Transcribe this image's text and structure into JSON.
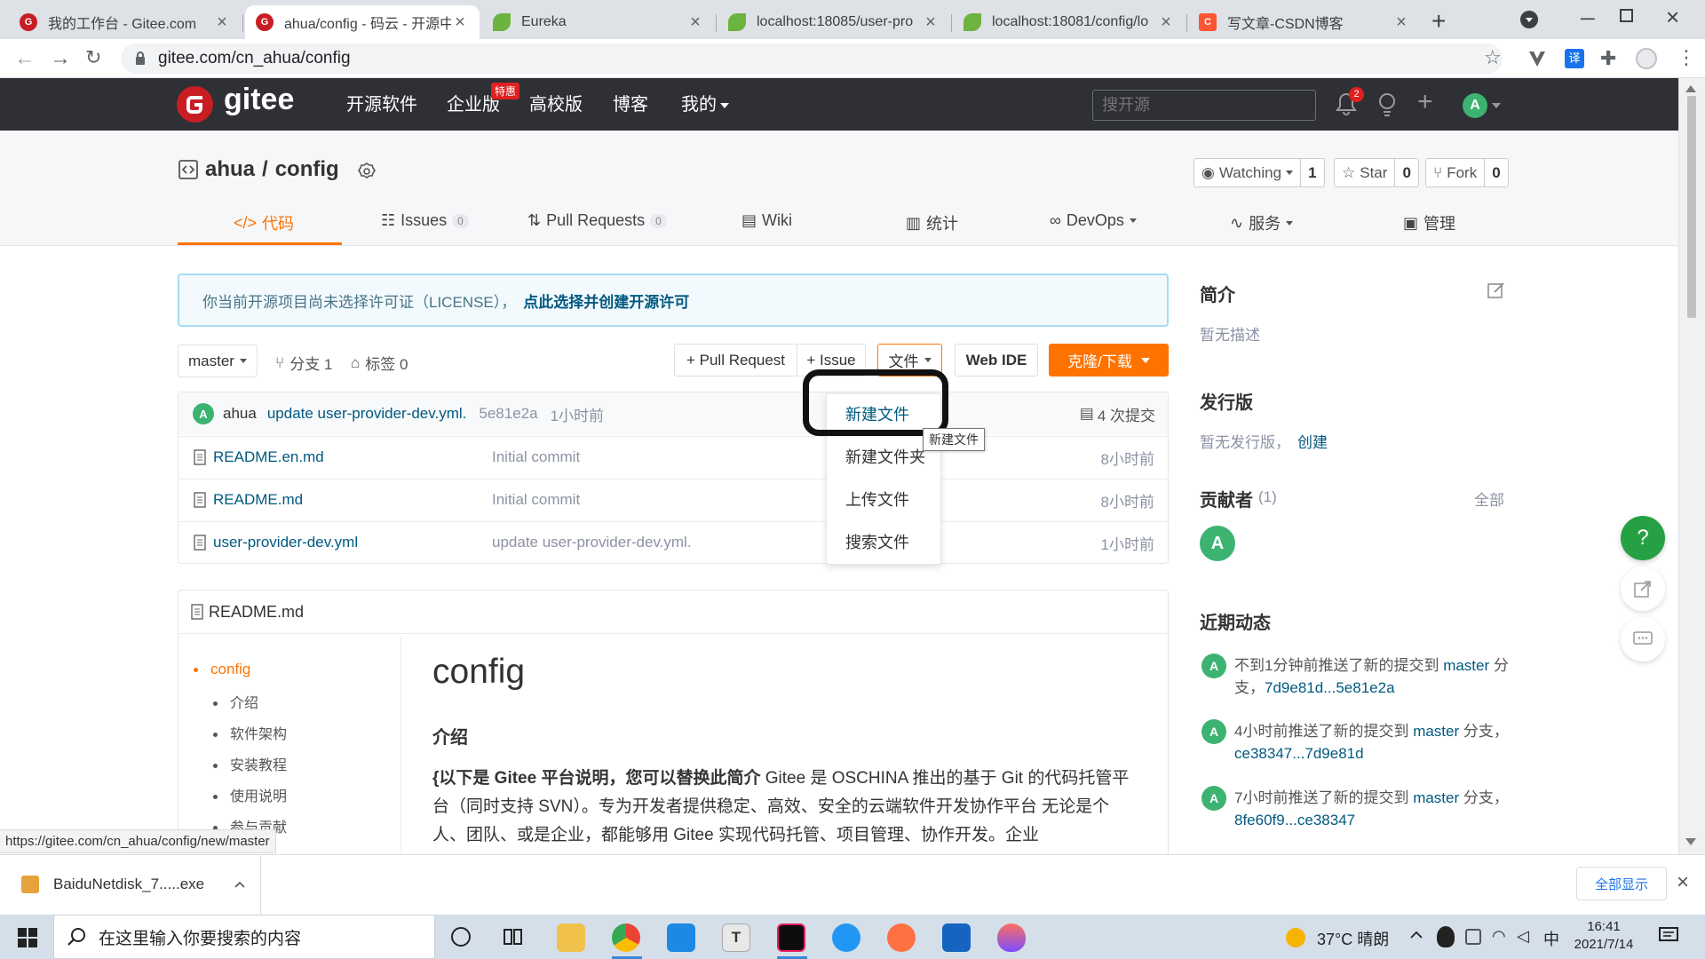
{
  "browser": {
    "tabs": [
      {
        "title": "我的工作台 - Gitee.com"
      },
      {
        "title": "ahua/config - 码云 - 开源中"
      },
      {
        "title": "Eureka"
      },
      {
        "title": "localhost:18085/user-pro"
      },
      {
        "title": "localhost:18081/config/lo"
      },
      {
        "title": "写文章-CSDN博客"
      }
    ],
    "url": "gitee.com/cn_ahua/config",
    "status_url": "https://gitee.com/cn_ahua/config/new/master"
  },
  "gitee": {
    "logo": "gitee",
    "nav": [
      "开源软件",
      "企业版",
      "高校版",
      "博客",
      "我的"
    ],
    "enterprise_badge": "特惠",
    "search_placeholder": "搜开源",
    "notif_count": "2",
    "user_initial": "A"
  },
  "repo": {
    "owner": "ahua",
    "sep": "/",
    "name": "config",
    "watch_label": "Watching",
    "watch_count": "1",
    "star_label": "Star",
    "star_count": "0",
    "fork_label": "Fork",
    "fork_count": "0",
    "tabs": {
      "code": "代码",
      "issues": "Issues",
      "issues_count": "0",
      "pr": "Pull Requests",
      "pr_count": "0",
      "wiki": "Wiki",
      "stats": "统计",
      "devops": "DevOps",
      "service": "服务",
      "manage": "管理"
    }
  },
  "license_notice": {
    "text": "你当前开源项目尚未选择许可证（LICENSE），",
    "link": "点此选择并创建开源许可"
  },
  "branchbar": {
    "branch": "master",
    "branches": "分支 1",
    "tags": "标签 0",
    "pull_request": "+ Pull Request",
    "issue": "+ Issue",
    "file": "文件",
    "webide": "Web IDE",
    "clone": "克隆/下载"
  },
  "file_menu": {
    "items": [
      "新建文件",
      "新建文件夹",
      "上传文件",
      "搜索文件"
    ],
    "tooltip": "新建文件"
  },
  "commit": {
    "avatar": "A",
    "author": "ahua",
    "message": "update user-provider-dev.yml.",
    "hash": "5e81e2a",
    "time": "1小时前",
    "count": "4 次提交"
  },
  "files": [
    {
      "name": "README.en.md",
      "message": "Initial commit",
      "time": "8小时前"
    },
    {
      "name": "README.md",
      "message": "Initial commit",
      "time": "8小时前"
    },
    {
      "name": "user-provider-dev.yml",
      "message": "update user-provider-dev.yml.",
      "time": "1小时前"
    }
  ],
  "readme": {
    "header": "README.md",
    "toc_title": "config",
    "toc": [
      "介绍",
      "软件架构",
      "安装教程",
      "使用说明",
      "参与贡献"
    ],
    "title": "config",
    "intro_heading": "介绍",
    "para_bold": "{以下是 Gitee 平台说明，您可以替换此简介",
    "para_rest": " Gitee 是 OSCHINA 推出的基于 Git 的代码托管平台（同时支持 SVN）。专为开发者提供稳定、高效、安全的云端软件开发协作平台 无论是个人、团队、或是企业，都能够用 Gitee 实现代码托管、项目管理、协作开发。企业"
  },
  "sidebar": {
    "intro_title": "简介",
    "intro_text": "暂无描述",
    "release_title": "发行版",
    "release_text": "暂无发行版，",
    "release_link": "创建",
    "contrib_title": "贡献者",
    "contrib_count": "(1)",
    "contrib_all": "全部",
    "contrib_avatar": "A",
    "activity_title": "近期动态",
    "activities": [
      {
        "text": "不到1分钟前推送了新的提交到 ",
        "branch": "master",
        "tail": " 分支，",
        "range": "7d9e81d...5e81e2a"
      },
      {
        "text": "4小时前推送了新的提交到 ",
        "branch": "master",
        "tail": " 分支，",
        "range": "ce38347...7d9e81d"
      },
      {
        "text": "7小时前推送了新的提交到 ",
        "branch": "master",
        "tail": " 分支，",
        "range": "8fe60f9...ce38347"
      }
    ]
  },
  "floating": {
    "help": "?"
  },
  "download": {
    "file": "BaiduNetdisk_7.....exe",
    "show_all": "全部显示"
  },
  "taskbar": {
    "search": "在这里输入你要搜索的内容",
    "weather": "37°C 晴朗",
    "ime": "中",
    "time": "16:41",
    "date": "2021/7/14"
  },
  "colors": {
    "gitee_red": "#c71d23",
    "accent_orange": "#fe7300",
    "link_blue": "#005980",
    "header_dark": "#2e3035"
  }
}
